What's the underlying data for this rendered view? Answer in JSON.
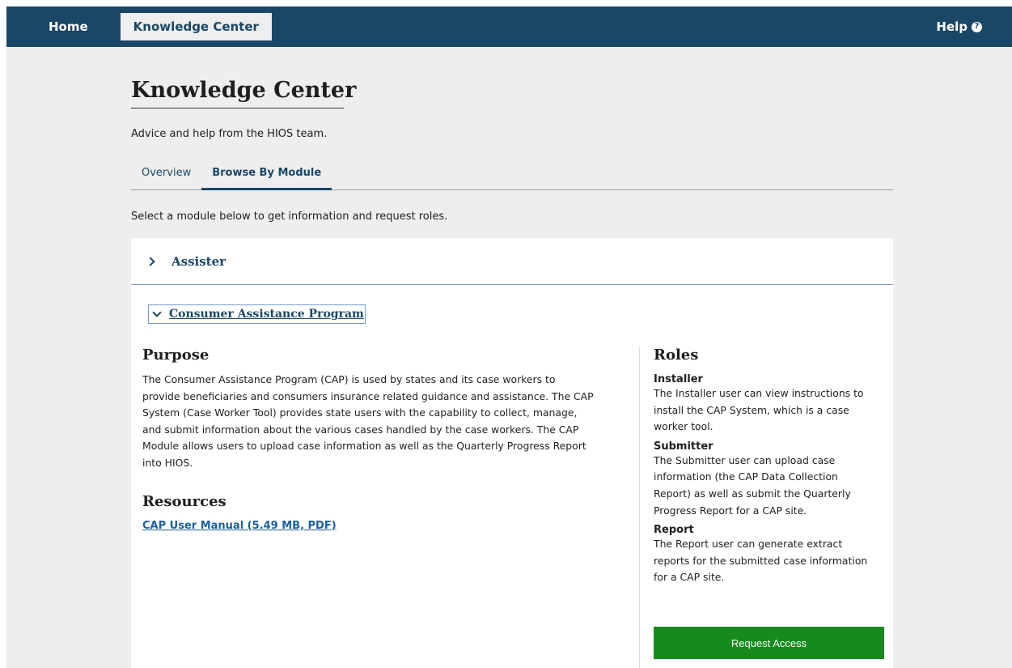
{
  "nav": {
    "home": "Home",
    "knowledge_center": "Knowledge Center",
    "help": "Help",
    "help_icon": "question-circle-icon"
  },
  "page": {
    "title": "Knowledge Center",
    "subtitle": "Advice and help from the HIOS team.",
    "tabs": [
      {
        "label": "Overview",
        "active": false
      },
      {
        "label": "Browse By Module",
        "active": true
      }
    ],
    "instructions": "Select a module below to get information and request roles."
  },
  "modules": [
    {
      "title": "Assister",
      "expanded": false
    },
    {
      "title": "Consumer Assistance Program",
      "expanded": true
    }
  ],
  "purpose": {
    "heading": "Purpose",
    "lines": [
      "The Consumer Assistance Program (CAP) is used by states and its case workers to",
      "provide beneficiaries and consumers insurance related guidance and assistance. The CAP",
      "System (Case Worker Tool) provides state users with the capability to collect, manage,",
      "and submit information about the various cases handled by the case workers. The CAP",
      "Module allows users to upload case information as well as the Quarterly Progress Report",
      "into HIOS."
    ]
  },
  "resources": {
    "heading": "Resources",
    "link": "CAP User Manual (5.49 MB, PDF)"
  },
  "roles": {
    "heading": "Roles",
    "items": [
      {
        "name": "Installer",
        "lines": [
          "The Installer user can view instructions to",
          "install the CAP System, which is a case",
          "worker tool."
        ]
      },
      {
        "name": "Submitter",
        "lines": [
          "The Submitter user can upload case",
          "information (the CAP Data Collection",
          "Report) as well as submit the Quarterly",
          "Progress Report for a CAP site."
        ]
      },
      {
        "name": "Report",
        "lines": [
          "The Report user can generate extract",
          "reports for the submitted case information",
          "for a CAP site."
        ]
      }
    ],
    "button": "Request Access"
  },
  "colors": {
    "nav_bg": "#1b4766",
    "page_bg": "#eeeeee",
    "accent": "#1b4766",
    "link": "#1b5fa0",
    "button": "#168a1c"
  }
}
